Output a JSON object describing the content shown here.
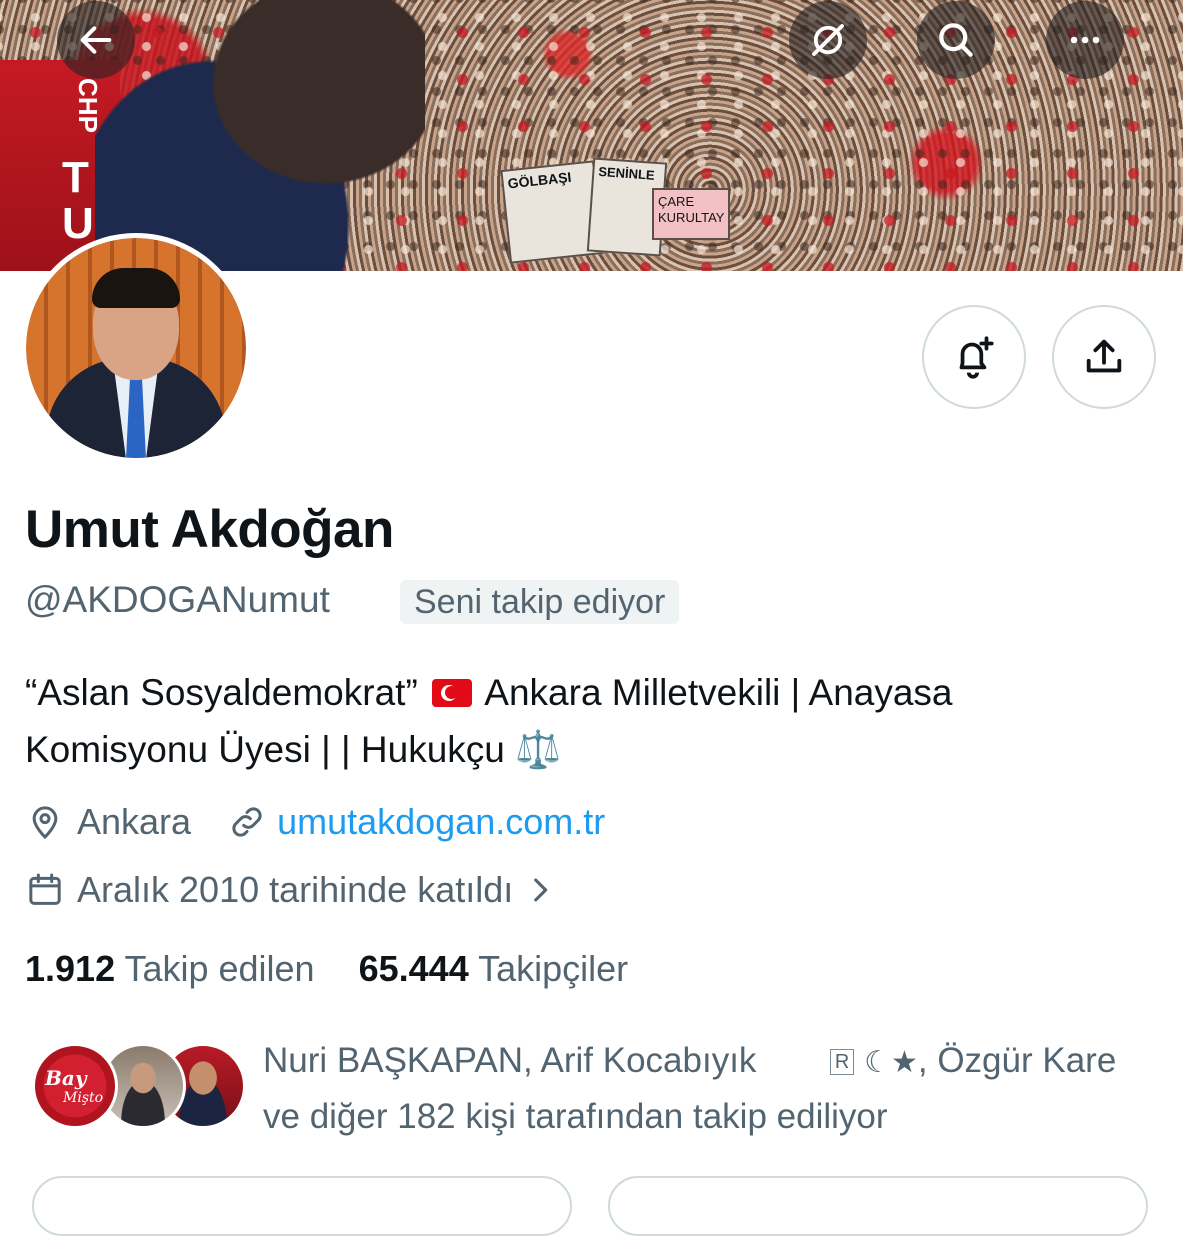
{
  "header": {
    "back_icon": "arrow-left-icon",
    "grok_icon": "grok-icon",
    "search_icon": "search-icon",
    "more_icon": "more-horizontal-icon"
  },
  "banner": {
    "signs": [
      "GÖLBAŞI",
      "SENİNLE",
      "ÇARE KURULTAY",
      "CHP",
      "TU"
    ]
  },
  "actions": {
    "notify_icon": "bell-plus-icon",
    "share_icon": "share-icon"
  },
  "profile": {
    "name": "Umut Akdoğan",
    "handle": "@AKDOGANumut",
    "follows_you": "Seni takip ediyor",
    "bio_part1": "“Aslan Sosyaldemokrat”",
    "bio_part2": "Ankara Milletvekili | Anayasa Komisyonu Üyesi | | Hukukçu",
    "bio_scale_emoji": "⚖️",
    "location": "Ankara",
    "website": "umutakdogan.com.tr",
    "joined": "Aralık 2010 tarihinde katıldı"
  },
  "stats": {
    "following_count": "1.912",
    "following_label": "Takip edilen",
    "followers_count": "65.444",
    "followers_label": "Takipçiler"
  },
  "followed_by": {
    "line1_a": "Nuri BAŞKAPAN, Arif Kocabıyık",
    "badge": "R",
    "line1_b": ", Özgür Kare",
    "line2": "ve diğer 182 kişi tarafından takip ediliyor",
    "avatar1_text1": "Bay",
    "avatar1_text2": "Mişto"
  },
  "colors": {
    "accent_link": "#1d9bf0",
    "secondary_text": "#536471",
    "primary_text": "#0f1419"
  }
}
